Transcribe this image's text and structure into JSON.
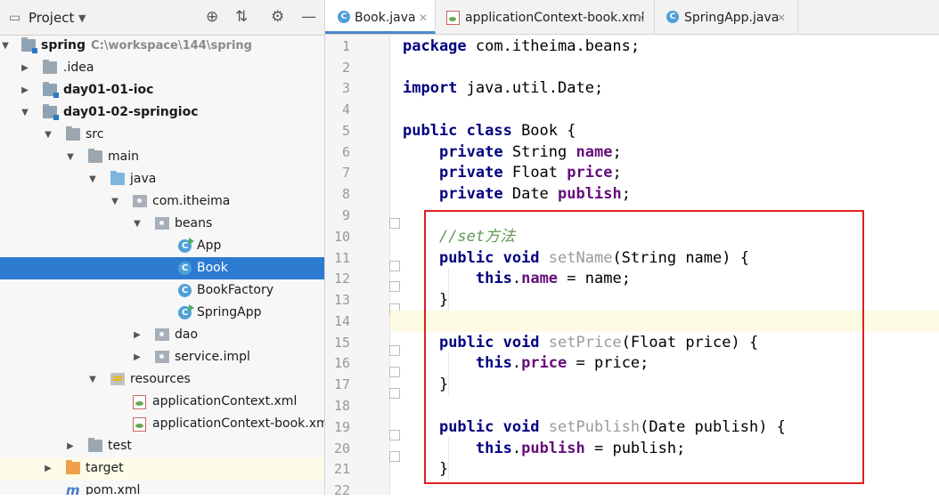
{
  "project_panel": {
    "title": "Project",
    "tools": [
      "crosshair-icon",
      "collapse-icon",
      "gear-icon",
      "minimize-icon"
    ],
    "tree": [
      {
        "label": "spring",
        "path": "C:\\workspace\\144\\spring",
        "bold": true
      },
      {
        "label": ".idea"
      },
      {
        "label": "day01-01-ioc",
        "bold": true
      },
      {
        "label": "day01-02-springioc",
        "bold": true
      },
      {
        "label": "src"
      },
      {
        "label": "main"
      },
      {
        "label": "java"
      },
      {
        "label": "com.itheima"
      },
      {
        "label": "beans"
      },
      {
        "label": "App"
      },
      {
        "label": "Book",
        "selected": true
      },
      {
        "label": "BookFactory"
      },
      {
        "label": "SpringApp"
      },
      {
        "label": "dao"
      },
      {
        "label": "service.impl"
      },
      {
        "label": "resources"
      },
      {
        "label": "applicationContext.xml"
      },
      {
        "label": "applicationContext-book.xml"
      },
      {
        "label": "test"
      },
      {
        "label": "target"
      },
      {
        "label": "pom.xml"
      }
    ]
  },
  "editor": {
    "tabs": [
      {
        "label": "Book.java",
        "active": true
      },
      {
        "label": "applicationContext-book.xml"
      },
      {
        "label": "SpringApp.java"
      }
    ],
    "line_numbers": [
      "1",
      "2",
      "3",
      "4",
      "5",
      "6",
      "7",
      "8",
      "9",
      "10",
      "11",
      "12",
      "13",
      "14",
      "15",
      "16",
      "17",
      "18",
      "19",
      "20",
      "21",
      "22"
    ],
    "current_line": 14,
    "code": {
      "l1": {
        "kw": "package",
        "rest": " com.itheima.beans;"
      },
      "l3": {
        "kw": "import",
        "rest": " java.util.Date;"
      },
      "l5": {
        "kw": "public class",
        "rest": " Book {"
      },
      "l6": {
        "kw": "private",
        "type": " String ",
        "field": "name",
        "end": ";"
      },
      "l7": {
        "kw": "private",
        "type": " Float ",
        "field": "price",
        "end": ";"
      },
      "l8": {
        "kw": "private",
        "type": " Date ",
        "field": "publish",
        "end": ";"
      },
      "l10": {
        "comment": "//set方法"
      },
      "l11": {
        "kw": "public void",
        "method": " setName",
        "rest": "(String name) {"
      },
      "l12": {
        "kw": "this",
        "dot": ".",
        "field": "name",
        "rest": " = name;"
      },
      "l13": {
        "rest": "}"
      },
      "l15": {
        "kw": "public void",
        "method": " setPrice",
        "rest": "(Float price) {"
      },
      "l16": {
        "kw": "this",
        "dot": ".",
        "field": "price",
        "rest": " = price;"
      },
      "l17": {
        "rest": "}"
      },
      "l19": {
        "kw": "public void",
        "method": " setPublish",
        "rest": "(Date publish) {"
      },
      "l20": {
        "kw": "this",
        "dot": ".",
        "field": "publish",
        "rest": " = publish;"
      },
      "l21": {
        "rest": "}"
      }
    }
  },
  "colors": {
    "selection": "#2d7bd0",
    "keyword": "#000080",
    "field": "#660e7a",
    "comment": "#629755",
    "annotation_box": "#e02020"
  }
}
